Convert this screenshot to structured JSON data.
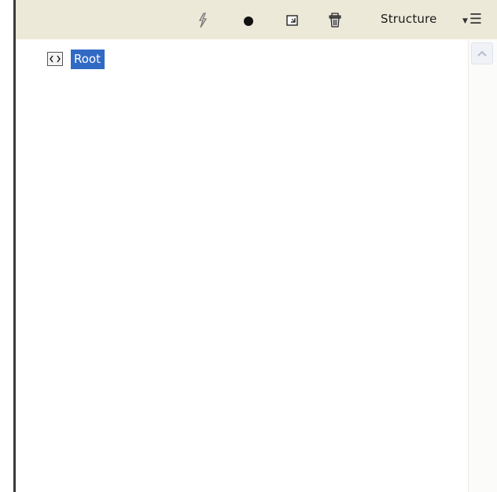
{
  "toolbar": {
    "icons": [
      {
        "name": "lightning-icon"
      },
      {
        "name": "record-dot-icon"
      },
      {
        "name": "new-element-icon"
      },
      {
        "name": "trash-icon"
      }
    ],
    "panel_title": "Structure",
    "menu_icon": "panel-menu-icon"
  },
  "tree": {
    "nodes": [
      {
        "label": "Root",
        "icon": "element-tag-icon",
        "selected": true
      }
    ]
  },
  "colors": {
    "toolbar_bg": "#ece9d8",
    "selection": "#316ac5"
  }
}
